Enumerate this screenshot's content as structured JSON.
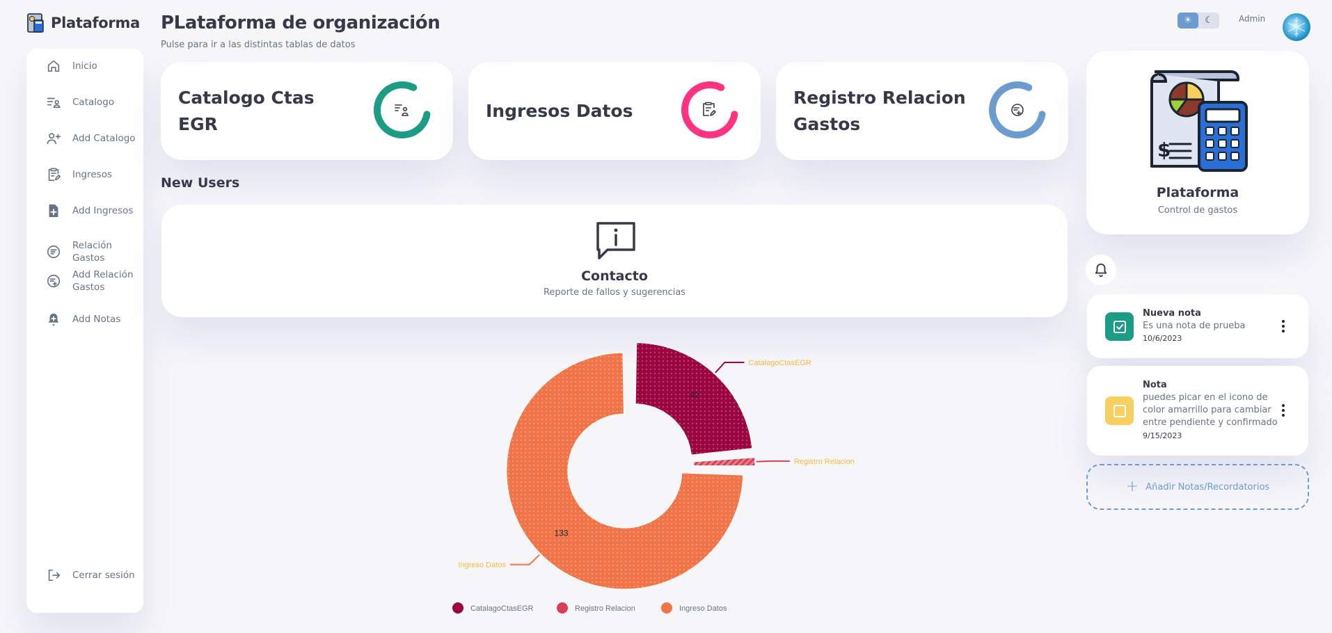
{
  "brand": {
    "name": "Plataforma"
  },
  "sidebar": {
    "items": [
      {
        "label": "Inicio"
      },
      {
        "label": "Catalogo"
      },
      {
        "label": "Add Catalogo"
      },
      {
        "label": "Ingresos"
      },
      {
        "label": "Add Ingresos"
      },
      {
        "label": "Relación Gastos"
      },
      {
        "label": "Add Relación Gastos"
      },
      {
        "label": "Add Notas"
      }
    ],
    "logout": "Cerrar sesión"
  },
  "header": {
    "title": "PLataforma de organización",
    "subtitle": "Pulse para ir a las distintas tablas de datos",
    "user": "Admin"
  },
  "cards": [
    {
      "title": "Catalogo Ctas EGR",
      "color": "#1b9c85"
    },
    {
      "title": "Ingresos Datos",
      "color": "#ff0060"
    },
    {
      "title": "Registro Relacion Gastos",
      "color": "#6c9bcf"
    }
  ],
  "section": {
    "title": "New Users"
  },
  "contact": {
    "title": "Contacto",
    "subtitle": "Reporte de fallos y sugerencias"
  },
  "chart_data": {
    "type": "pie",
    "categories": [
      "CatalagoCtasEGR",
      "Registro Relacion",
      "Ingreso Datos"
    ],
    "values": [
      42,
      3,
      133
    ],
    "data_labels": [
      "42",
      "",
      "133"
    ],
    "colors": [
      "#9b0540",
      "#d63f55",
      "#f07448"
    ],
    "label_color": "#f5b942",
    "legend_position": "bottom",
    "donut": true
  },
  "profile": {
    "name": "Plataforma",
    "role": "Control de gastos"
  },
  "notes": [
    {
      "title": "Nueva nota",
      "text": "Es una nota de prueba",
      "date": "10/6/2023",
      "status_color": "#1b9c85"
    },
    {
      "title": "Nota",
      "text": "puedes picar en el icono de color amarrillo para cambiar entre pendiente y confirmado",
      "date": "9/15/2023",
      "status_color": "#f7d060"
    }
  ],
  "add_note": {
    "label": "Añadir Notas/Recordatorios"
  }
}
